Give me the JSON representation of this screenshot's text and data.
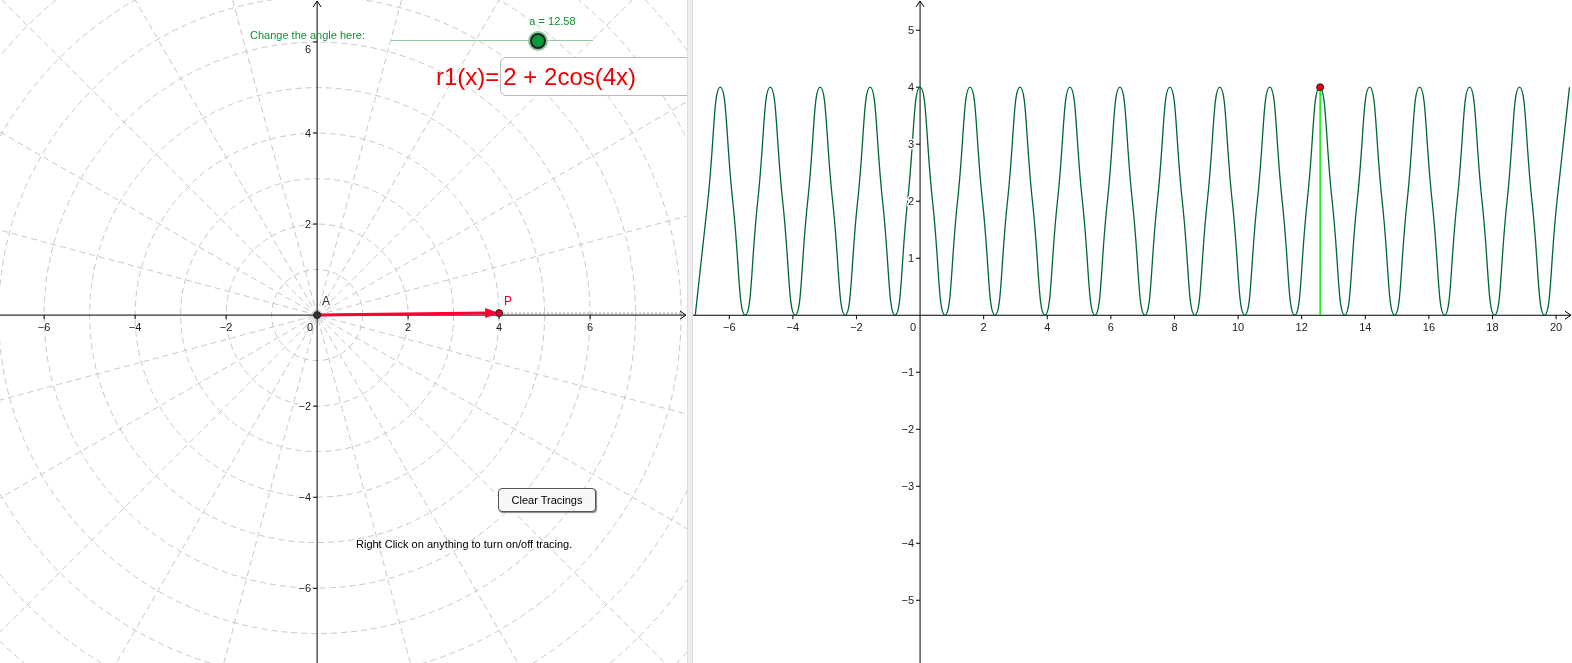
{
  "graphics_view": {
    "slider": {
      "label": "Change the angle here:",
      "caption": "a = 12.58",
      "level": 0.73
    },
    "function_input": {
      "label": "r1(x)=",
      "value": "2 + 2cos(4x)"
    },
    "clear_button": "Clear Tracings",
    "origin_label": "0",
    "note": "Right Click on anything to turn on/off tracing.",
    "chart_data": {
      "type": "scatter",
      "x": [
        0,
        4
      ],
      "series": [
        {
          "name": "A",
          "color": "#333333",
          "values": [
            0,
            null
          ]
        },
        {
          "name": "P",
          "color": "#e0002a",
          "values": [
            null,
            0
          ]
        }
      ],
      "xlim": [
        -6.97,
        8.13
      ],
      "ylim": [
        -7.64,
        6.92
      ],
      "xticks": [
        {
          "value": -6,
          "label": "−6"
        },
        {
          "value": -4,
          "label": "−4"
        },
        {
          "value": -2,
          "label": "−2"
        },
        {
          "value": 2,
          "label": "2"
        },
        {
          "value": 4,
          "label": "4"
        },
        {
          "value": 6,
          "label": "6"
        }
      ],
      "yticks": [
        {
          "value": -6,
          "label": "−6"
        },
        {
          "value": -4,
          "label": "−4"
        },
        {
          "value": -2,
          "label": "−2"
        },
        {
          "value": 2,
          "label": "2"
        },
        {
          "value": 4,
          "label": "4"
        },
        {
          "value": 6,
          "label": "6"
        }
      ]
    }
  },
  "graphics_view_2": {
    "origin_label": "0",
    "chart_data": {
      "type": "line",
      "x": [
        -7.069,
        -6.676,
        -6.283,
        -5.89,
        -5.498,
        -5.105,
        -4.712,
        -4.32,
        -3.927,
        -3.534,
        -3.142,
        -2.749,
        -2.356,
        -1.963,
        -1.571,
        -1.178,
        -0.785,
        -0.393,
        0,
        0.393,
        0.785,
        1.178,
        1.571,
        1.963,
        2.356,
        2.749,
        3.142,
        3.534,
        3.927,
        4.32,
        4.712,
        5.105,
        5.498,
        5.89,
        6.283,
        6.676,
        7.069,
        7.461,
        7.854,
        8.247,
        8.639,
        9.032,
        9.425,
        9.817,
        10.21,
        10.603,
        10.996,
        11.388,
        11.781,
        12.174,
        12.566,
        12.959,
        13.352,
        13.744,
        14.137,
        14.53,
        14.923,
        15.315,
        15.708,
        16.101,
        16.493,
        16.886,
        17.279,
        17.671,
        18.064,
        18.457,
        18.85,
        19.242,
        19.635,
        20.028,
        20.42
      ],
      "series": [
        {
          "color": "#006633",
          "values": [
            0,
            2,
            4,
            2,
            0,
            2,
            4,
            2,
            0,
            2,
            4,
            2,
            0,
            2,
            4,
            2,
            0,
            2,
            4,
            2,
            0,
            2,
            4,
            2,
            0,
            2,
            4,
            2,
            0,
            2,
            4,
            2,
            0,
            2,
            4,
            2,
            0,
            2,
            4,
            2,
            0,
            2,
            4,
            2,
            0,
            2,
            4,
            2,
            0,
            2,
            4,
            2,
            0,
            2,
            4,
            2,
            0,
            2,
            4,
            2,
            0,
            2,
            4,
            2,
            0,
            2,
            4,
            2,
            0,
            2,
            4
          ]
        }
      ],
      "xlim": [
        -7.14,
        20.5
      ],
      "ylim": [
        -6.1,
        5.53
      ],
      "xticks": [
        {
          "value": -6,
          "label": "−6"
        },
        {
          "value": -4,
          "label": "−4"
        },
        {
          "value": -2,
          "label": "−2"
        },
        {
          "value": 2,
          "label": "2"
        },
        {
          "value": 4,
          "label": "4"
        },
        {
          "value": 6,
          "label": "6"
        },
        {
          "value": 8,
          "label": "8"
        },
        {
          "value": 10,
          "label": "10"
        },
        {
          "value": 12,
          "label": "12"
        },
        {
          "value": 14,
          "label": "14"
        },
        {
          "value": 16,
          "label": "16"
        },
        {
          "value": 18,
          "label": "18"
        },
        {
          "value": 20,
          "label": "20"
        }
      ],
      "yticks": [
        {
          "value": -5,
          "label": "−5"
        },
        {
          "value": -4,
          "label": "−4"
        },
        {
          "value": -3,
          "label": "−3"
        },
        {
          "value": -2,
          "label": "−2"
        },
        {
          "value": -1,
          "label": "−1"
        },
        {
          "value": 1,
          "label": "1"
        },
        {
          "value": 2,
          "label": "2"
        },
        {
          "value": 3,
          "label": "3"
        },
        {
          "value": 4,
          "label": "4"
        },
        {
          "value": 5,
          "label": "5"
        }
      ],
      "ref_lines": [
        {
          "axis": "x",
          "value": 12.58
        }
      ]
    }
  }
}
